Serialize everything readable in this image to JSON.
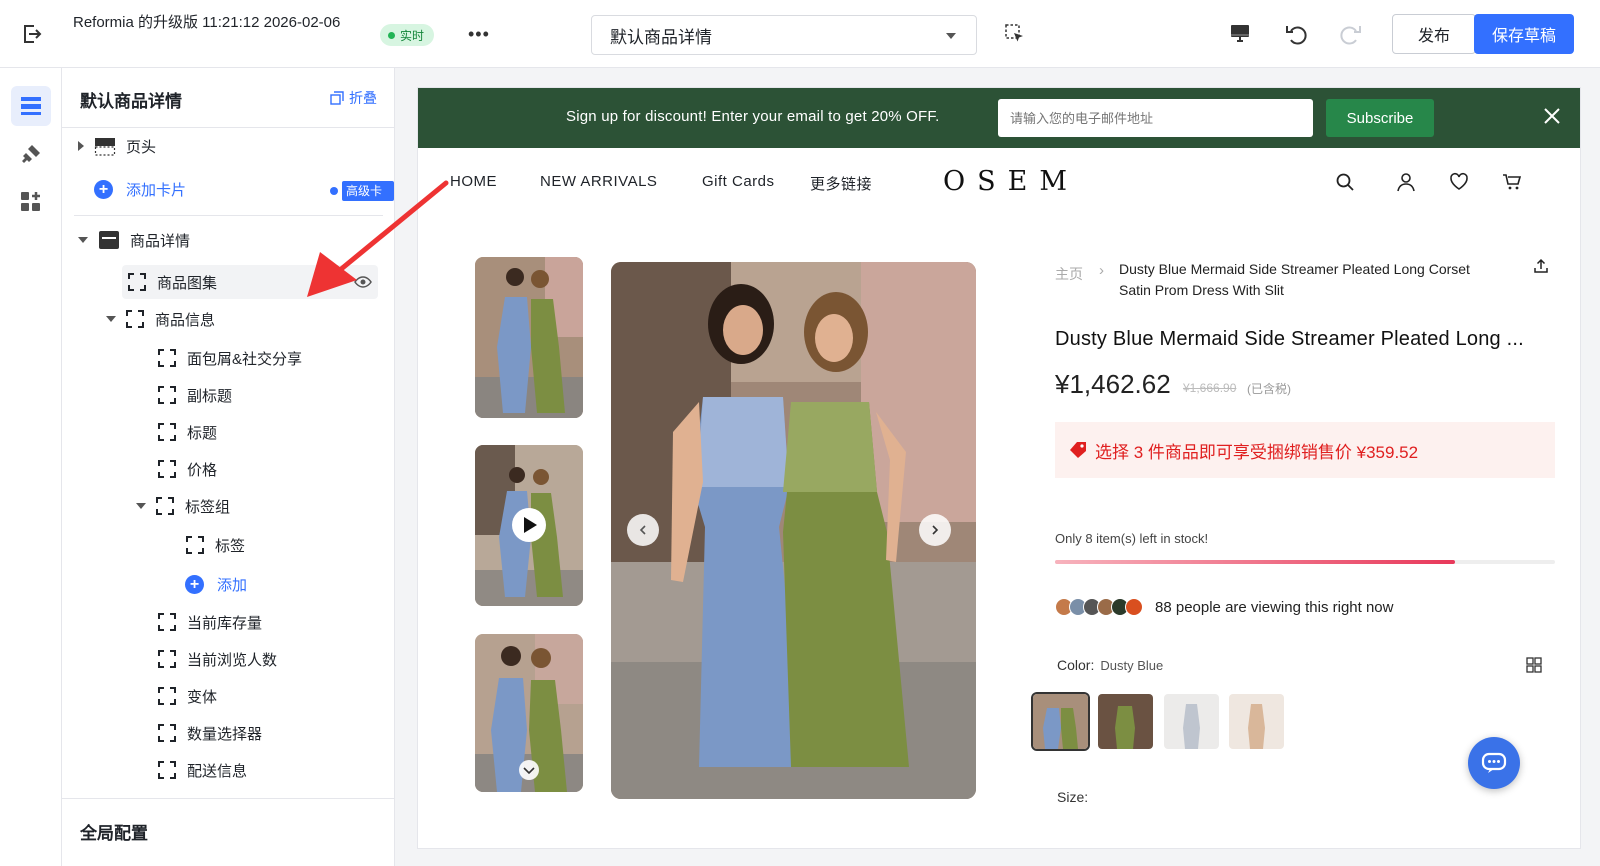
{
  "topbar": {
    "doc_title": "Reformia 的升级版 11:21:12 2026-02-06",
    "live_label": "实时",
    "page_select_value": "默认商品详情",
    "publish_label": "发布",
    "save_label": "保存草稿"
  },
  "panel": {
    "title": "默认商品详情",
    "collapse_label": "折叠",
    "header_item": "页头",
    "add_card": "添加卡片",
    "advanced_badge": "高级卡片广场",
    "product_detail": "商品详情",
    "gallery": "商品图集",
    "product_info": "商品信息",
    "children": {
      "breadcrumb_share": "面包屑&社交分享",
      "subtitle": "副标题",
      "title": "标题",
      "price": "价格",
      "tag_group": "标签组",
      "tag": "标签",
      "add": "添加",
      "stock": "当前库存量",
      "viewers": "当前浏览人数",
      "variant": "变体",
      "quantity": "数量选择器",
      "shipping": "配送信息"
    },
    "global_config": "全局配置"
  },
  "store": {
    "promo_text": "Sign up for discount! Enter your email to get 20% OFF.",
    "email_placeholder": "请输入您的电子邮件地址",
    "subscribe_label": "Subscribe",
    "nav": {
      "home": "HOME",
      "new_arrivals": "NEW ARRIVALS",
      "gift_cards": "Gift Cards",
      "more_links": "更多链接",
      "logo": "OSEM"
    },
    "breadcrumb_home": "主页",
    "breadcrumb_sep": "›",
    "breadcrumb_current": "Dusty Blue Mermaid Side Streamer Pleated Long Corset Satin Prom Dress With Slit",
    "product_title": "Dusty Blue Mermaid Side Streamer Pleated Long ...",
    "price": "¥1,462.62",
    "price_original": "¥1,666.90",
    "price_tax": "(已含税)",
    "bundle_text": "选择 3 件商品即可享受捆绑销售价 ¥359.52",
    "stock_text": "Only 8 item(s) left in stock!",
    "stock_fraction": 0.8,
    "viewers_text": "88 people are viewing this right now",
    "color_label": "Color:",
    "color_value": "Dusty Blue",
    "size_label": "Size:"
  },
  "colors": {
    "accent": "#3370ff",
    "promo_bg": "#2c5236",
    "subscribe_bg": "#27874a",
    "bundle_text": "#e02020",
    "chat_bg": "#3a72e8"
  }
}
